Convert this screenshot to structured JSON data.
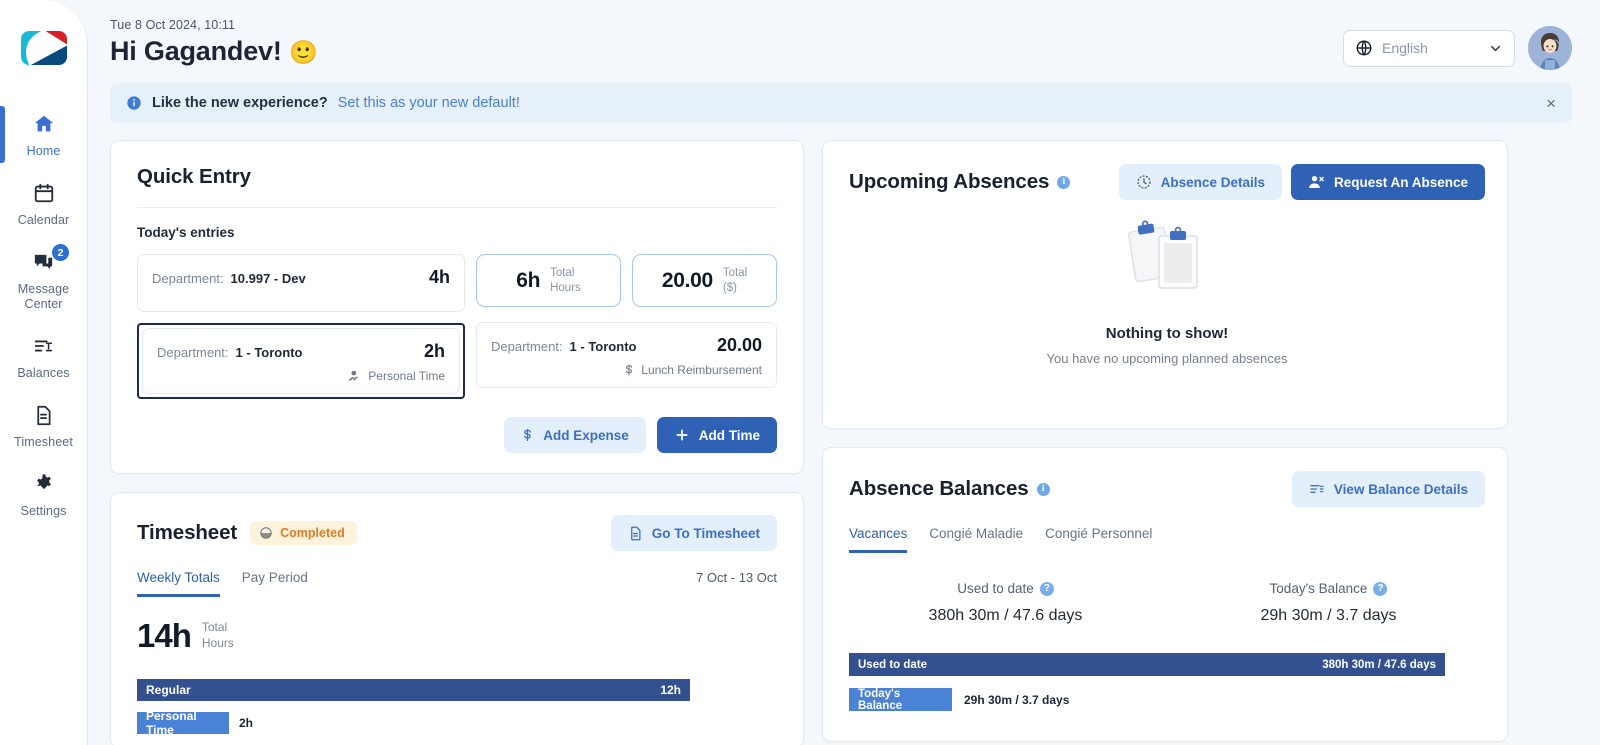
{
  "sidebar": {
    "logo_name": "company-logo",
    "items": [
      {
        "label": "Home",
        "icon": "home-icon",
        "active": true,
        "badge": null
      },
      {
        "label": "Calendar",
        "icon": "calendar-icon",
        "active": false,
        "badge": null
      },
      {
        "label": "Message Center",
        "icon": "messages-icon",
        "active": false,
        "badge": "2"
      },
      {
        "label": "Balances",
        "icon": "balances-icon",
        "active": false,
        "badge": null
      },
      {
        "label": "Timesheet",
        "icon": "document-icon",
        "active": false,
        "badge": null
      },
      {
        "label": "Settings",
        "icon": "gear-icon",
        "active": false,
        "badge": null
      }
    ]
  },
  "header": {
    "date": "Tue 8 Oct 2024, 10:11",
    "greeting": "Hi Gagandev!",
    "greeting_emoji": "🙂",
    "language": {
      "value": "English",
      "icon": "globe-icon",
      "chevron": "chevron-down-icon"
    },
    "avatar_alt": "user-avatar"
  },
  "banner": {
    "icon": "info-icon",
    "text": "Like the new experience?",
    "link": "Set this as your new default!",
    "close": "×"
  },
  "quick_entry": {
    "title": "Quick Entry",
    "subtitle": "Today's entries",
    "time_entries": [
      {
        "label": "Department:",
        "value": "10.997 - Dev",
        "amount": "4h",
        "tag": null,
        "tag_icon": null,
        "selected": false
      },
      {
        "label": "Department:",
        "value": "1 - Toronto",
        "amount": "2h",
        "tag": "Personal Time",
        "tag_icon": "person-check-icon",
        "selected": true
      }
    ],
    "totals": [
      {
        "value": "6h",
        "label_line1": "Total",
        "label_line2": "Hours"
      },
      {
        "value": "20.00",
        "label_line1": "Total",
        "label_line2": "($)"
      }
    ],
    "expense_entries": [
      {
        "label": "Department:",
        "value": "1 - Toronto",
        "amount": "20.00",
        "tag": "Lunch Reimbursement",
        "tag_icon": "dollar-icon"
      }
    ],
    "actions": {
      "add_expense": {
        "label": "Add Expense",
        "icon": "dollar-icon"
      },
      "add_time": {
        "label": "Add Time",
        "icon": "plus-icon"
      }
    }
  },
  "timesheet": {
    "title": "Timesheet",
    "status": {
      "label": "Completed",
      "icon": "half-circle-icon",
      "color": "#d97c22",
      "bg": "#fdf3dd"
    },
    "go_button": {
      "label": "Go To Timesheet",
      "icon": "document-icon"
    },
    "tabs": [
      {
        "label": "Weekly Totals",
        "active": true
      },
      {
        "label": "Pay Period",
        "active": false
      }
    ],
    "date_range": "7 Oct - 13 Oct",
    "total": {
      "value": "14h",
      "label_line1": "Total",
      "label_line2": "Hours"
    },
    "chart_data": {
      "type": "bar",
      "orientation": "horizontal",
      "title": "Weekly Totals",
      "categories": [
        "Regular",
        "Personal Time"
      ],
      "values": [
        12,
        2
      ],
      "value_labels": [
        "12h",
        "2h"
      ],
      "unit": "hours",
      "colors": [
        "#33508f",
        "#4a82d6"
      ],
      "xlim": [
        0,
        12
      ],
      "grid": false,
      "legend": "none"
    }
  },
  "upcoming_absences": {
    "title": "Upcoming Absences",
    "info_icon": "info-icon",
    "buttons": {
      "details": {
        "label": "Absence Details",
        "icon": "clock-icon"
      },
      "request": {
        "label": "Request An Absence",
        "icon": "person-remove-icon"
      }
    },
    "empty": {
      "illustration": "clipboards-illustration",
      "title": "Nothing to show!",
      "subtitle": "You have no upcoming planned absences"
    }
  },
  "absence_balances": {
    "title": "Absence Balances",
    "info_icon": "info-icon",
    "view_button": {
      "label": "View Balance Details",
      "icon": "list-details-icon"
    },
    "tabs": [
      {
        "label": "Vacances",
        "active": true
      },
      {
        "label": "Congié Maladie",
        "active": false
      },
      {
        "label": "Congié Personnel",
        "active": false
      }
    ],
    "summary": [
      {
        "label": "Used to date",
        "help": "?",
        "value": "380h 30m / 47.6 days"
      },
      {
        "label": "Today's Balance",
        "help": "?",
        "value": "29h 30m / 3.7 days"
      }
    ],
    "chart_data": {
      "type": "bar",
      "orientation": "horizontal",
      "title": "Vacances balances",
      "categories": [
        "Used to date",
        "Today's Balance"
      ],
      "values": [
        380.5,
        29.5
      ],
      "value_labels": [
        "380h 30m / 47.6 days",
        "29h 30m / 3.7 days"
      ],
      "days_values": [
        47.6,
        3.7
      ],
      "unit": "hours",
      "colors": [
        "#33508f",
        "#4a82d6"
      ],
      "xlim": [
        0,
        380.5
      ],
      "grid": false,
      "legend": "none"
    }
  }
}
